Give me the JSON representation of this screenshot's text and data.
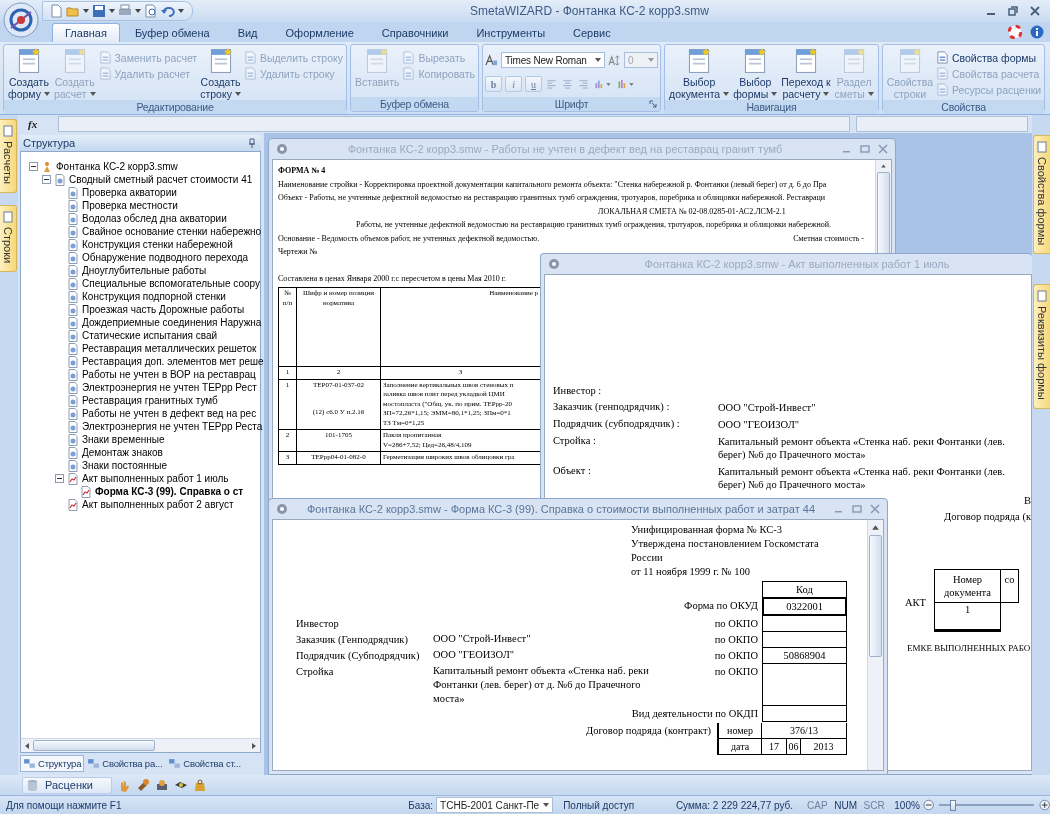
{
  "app": {
    "title": "SmetaWIZARD - Фонтанка КС-2 корр3.smw"
  },
  "ribbon_tabs": [
    {
      "label": "Главная",
      "selected": true
    },
    {
      "label": "Буфер обмена",
      "selected": false
    },
    {
      "label": "Вид",
      "selected": false
    },
    {
      "label": "Оформление",
      "selected": false
    },
    {
      "label": "Справочники",
      "selected": false
    },
    {
      "label": "Инструменты",
      "selected": false
    },
    {
      "label": "Сервис",
      "selected": false
    }
  ],
  "ribbon_groups": [
    {
      "title": "Редактирование",
      "items": [
        {
          "kind": "large",
          "lines": [
            "Создать",
            "форму"
          ],
          "dropdown": true,
          "disabled": false
        },
        {
          "kind": "large",
          "lines": [
            "Создать",
            "расчет"
          ],
          "dropdown": true,
          "disabled": true
        },
        {
          "kind": "stack",
          "buttons": [
            {
              "label": "Заменить расчет",
              "disabled": true
            },
            {
              "label": "Удалить расчет",
              "disabled": true
            }
          ]
        },
        {
          "kind": "large",
          "lines": [
            "Создать",
            "строку"
          ],
          "dropdown": true,
          "disabled": false
        },
        {
          "kind": "stack",
          "buttons": [
            {
              "label": "Выделить строку",
              "disabled": true
            },
            {
              "label": "Удалить строку",
              "disabled": true
            }
          ]
        }
      ]
    },
    {
      "title": "Буфер обмена",
      "items": [
        {
          "kind": "large",
          "lines": [
            "Вставить"
          ],
          "dropdown": false,
          "disabled": true
        },
        {
          "kind": "stack",
          "buttons": [
            {
              "label": "Вырезать",
              "disabled": true
            },
            {
              "label": "Копировать",
              "disabled": true
            }
          ]
        }
      ]
    },
    {
      "title": "Шрифт",
      "items": [
        {
          "kind": "font",
          "font_field": {
            "value": "Times New Roman"
          },
          "size_field": {
            "value": "0",
            "disabled": true
          },
          "format": [
            "b",
            "i",
            "u"
          ]
        }
      ]
    },
    {
      "title": "Навигация",
      "items": [
        {
          "kind": "large",
          "lines": [
            "Выбор",
            "документа"
          ],
          "dropdown": true,
          "disabled": false
        },
        {
          "kind": "large",
          "lines": [
            "Выбор",
            "формы"
          ],
          "dropdown": true,
          "disabled": false
        },
        {
          "kind": "large",
          "lines": [
            "Переход к",
            "расчету"
          ],
          "dropdown": true,
          "disabled": false
        },
        {
          "kind": "large",
          "lines": [
            "Раздел",
            "сметы"
          ],
          "dropdown": true,
          "disabled": true
        }
      ]
    },
    {
      "title": "Свойства",
      "items": [
        {
          "kind": "large",
          "lines": [
            "Свойства",
            "строки"
          ],
          "dropdown": false,
          "disabled": true
        },
        {
          "kind": "stack",
          "buttons": [
            {
              "label": "Свойства формы",
              "disabled": false
            },
            {
              "label": "Свойства расчета",
              "disabled": true
            },
            {
              "label": "Ресурсы расценки",
              "disabled": true
            }
          ]
        }
      ]
    }
  ],
  "formula_bar": {
    "label": "fx"
  },
  "left_tabs": [
    {
      "label": "Расчеты"
    },
    {
      "label": "Строки"
    }
  ],
  "right_tabs": [
    {
      "label": "Свойства формы"
    },
    {
      "label": "Реквизиты формы"
    }
  ],
  "structure": {
    "title": "Структура",
    "tree": [
      {
        "label": "Фонтанка КС-2 корр3.smw",
        "kind": "file",
        "expanded": true,
        "selected": false,
        "children": [
          {
            "label": "Сводный сметный расчет стоимости 41",
            "kind": "summary",
            "expanded": true,
            "selected": false,
            "children": [
              {
                "label": "Проверка акватории",
                "kind": "calc",
                "selected": false
              },
              {
                "label": "Проверка местности",
                "kind": "calc",
                "selected": false
              },
              {
                "label": "Водолаз обслед дна акватории",
                "kind": "calc",
                "selected": false
              },
              {
                "label": "Свайное основание стенки набережно",
                "kind": "calc",
                "selected": false
              },
              {
                "label": "Конструкция стенки набережной",
                "kind": "calc",
                "selected": false
              },
              {
                "label": "Обнаружение подводного перехода",
                "kind": "calc",
                "selected": false
              },
              {
                "label": "Дноуглубительные работы",
                "kind": "calc",
                "selected": false
              },
              {
                "label": "Специальные вспомогательные соору",
                "kind": "calc",
                "selected": false
              },
              {
                "label": "Конструкция подпорной стенки",
                "kind": "calc",
                "selected": false
              },
              {
                "label": "Проезжая часть Дорожные работы",
                "kind": "calc",
                "selected": false
              },
              {
                "label": "Дождеприемные соединения Наружна",
                "kind": "calc",
                "selected": false
              },
              {
                "label": "Статические испытания свай",
                "kind": "calc",
                "selected": false
              },
              {
                "label": "Реставрация металлических решеток",
                "kind": "calc",
                "selected": false
              },
              {
                "label": "Реставрация доп. элементов мет реше",
                "kind": "calc",
                "selected": false
              },
              {
                "label": "Работы не учтен в ВОР на реставрац",
                "kind": "calc",
                "selected": false
              },
              {
                "label": "Электроэнергия не учтен ТЕРрр Рест",
                "kind": "calc",
                "selected": false
              },
              {
                "label": "Реставрация гранитных тумб",
                "kind": "calc",
                "selected": false
              },
              {
                "label": "Работы не учтен в дефект вед на рес",
                "kind": "calc",
                "selected": false
              },
              {
                "label": "Электроэнергия не учтен ТЕРрр Реста",
                "kind": "calc",
                "selected": false
              },
              {
                "label": "Знаки временные",
                "kind": "calc",
                "selected": false
              },
              {
                "label": "Демонтаж знаков",
                "kind": "calc",
                "selected": false
              },
              {
                "label": "Знаки постоянные",
                "kind": "calc",
                "selected": false
              },
              {
                "label": "Акт выполненных работ 1 июль",
                "kind": "act",
                "expanded": true,
                "selected": false,
                "children": [
                  {
                    "label": "Форма КС-3 (99). Справка о ст",
                    "kind": "form",
                    "selected": true
                  }
                ]
              },
              {
                "label": "Акт выполненных работ 2 август",
                "kind": "act",
                "selected": false
              }
            ]
          }
        ]
      }
    ],
    "bottom_tabs": [
      {
        "label": "Структура",
        "selected": true
      },
      {
        "label": "Свойства ра...",
        "selected": false
      },
      {
        "label": "Свойства ст...",
        "selected": false
      }
    ]
  },
  "windows": [
    {
      "kind": "estimate",
      "title": "Фонтанка КС-2 корр3.smw - Работы не учтен в дефект вед на реставрац гранит тумб",
      "active": false,
      "form_label": "ФОРМА № 4",
      "lines": [
        "Наименование стройки - Корректировка проектной документации капитального ремонта объекта: \"Стенка набережной р. Фонтанки (левый берег) от д. 6 до Пра",
        "Объект - Работы, не учтенные дефектной ведомостью на реставрацию гранитных тумб ограждения, тротуаров, поребрика и облицовки набережной. Реставраци"
      ],
      "heading": "ЛОКАЛЬНАЯ СМЕТА № 02-08.0285-01-АС2.ЛСМ-2.1",
      "subheading": "Работы, не учтенные дефектной ведомостью на реставрацию гранитных тумб ограждения, тротуаров, поребрика и облицовки набережной.",
      "basis": "Основание - Ведомость объемов работ, не учтенных дефектной ведомостью.",
      "cost_label": "Сметная стоимость -",
      "drawings": "Чертежи №",
      "prices": "Составлена в ценах Января 2000 г.с пересчетом в цены Мая 2010 г.",
      "table": {
        "columns": [
          "№ п/п",
          "Шифр и номер позиции норматива",
          "Наименование р"
        ],
        "column_numbers": [
          "1",
          "2",
          "3"
        ],
        "rows": [
          {
            "num": "1",
            "code": [
              "ТЕР07-01-037-02",
              "(12) с6.0 У п.2.16"
            ],
            "desc": [
              "Заполнение вертикальных швов стеновых п",
              "заливка швов плит перед укладкой ЦМИ",
              "мостопласта (\"Общ. ук. по прим. ТЕРрр-20",
              "ЗП=72,26*1,15; ЭММ=80,1*1,25; ЗПм=0*1",
              "ТЗ Тм=0*1,25"
            ]
          },
          {
            "num": "2",
            "code": [
              "101-1705"
            ],
            "desc": [
              "Пакля пропитанная",
              "V=286+7,52; Цед=26,48/4,109"
            ]
          },
          {
            "num": "3",
            "code": [
              "ТЕРрр04-01-082-0"
            ],
            "desc": [
              "Герметизация широких швов облицовки гра"
            ]
          }
        ]
      }
    },
    {
      "kind": "act",
      "title": "Фонтанка КС-2 корр3.smw - Акт выполненных работ 1 июль",
      "active": false,
      "fields": [
        {
          "label": "Инвестор :"
        },
        {
          "label": "Заказчик (генподрядчик) :",
          "value": "ООО \"Строй-Инвест\""
        },
        {
          "label": "Подрядчик (субподрядчик) :",
          "value": "ООО \"ГЕОИЗОЛ\""
        },
        {
          "label": "Стройка :",
          "value": "Капитальный ремонт объекта «Стенка наб. реки Фонтанки (лев. берег) №6 до Прачечного моста»"
        },
        {
          "label": "Объект :",
          "value": "Капитальный ремонт объекта «Стенка наб. реки Фонтанки (лев. берег) №6 до Прачечного моста»"
        }
      ],
      "right_lines": [
        "В",
        "Договор подряда (к"
      ],
      "doc_table": {
        "row_label": "АКТ",
        "columns": [
          "Номер документа",
          "со"
        ],
        "values": [
          "1"
        ]
      },
      "footer": "ЕМКЕ ВЫПОЛНЕННЫХ РАБО"
    },
    {
      "kind": "ks3",
      "title": "Фонтанка КС-2 корр3.smw - Форма КС-3 (99). Справка о стоимости выполненных работ и затрат 44",
      "active": true,
      "header": [
        "Унифицированная форма № КС-3",
        "Утверждена постановлением Госкомстата России",
        "от 11 ноября 1999 г. № 100"
      ],
      "code_header": "Код",
      "rows": [
        {
          "code_label": "Форма по ОКУД",
          "code": "0322001"
        },
        {
          "party": {
            "label": "Инвестор"
          },
          "code_label": "по ОКПО"
        },
        {
          "party": {
            "label": "Заказчик (Генподрядчик)",
            "value": "ООО \"Строй-Инвест\""
          },
          "code_label": "по ОКПО"
        },
        {
          "party": {
            "label": "Подрядчик (Субподрядчик)",
            "value": "ООО \"ГЕОИЗОЛ\""
          },
          "code_label": "по ОКПО",
          "code": "50868904"
        },
        {
          "party": {
            "label": "Стройка",
            "value": "Капитальный ремонт объекта «Стенка наб. реки Фонтанки (лев. берег) от д. №6 до Прачечного моста»"
          },
          "code_label": "по ОКПО"
        },
        {
          "code_label": "Вид деятельности по ОКДП"
        }
      ],
      "contract": {
        "label": "Договор подряда (контракт)",
        "number_label": "номер",
        "number": "376/13",
        "date_label": "дата",
        "date": [
          "17",
          "06",
          "2013"
        ]
      }
    }
  ],
  "bottom_bar": {
    "label": "Расценки"
  },
  "status_bar": {
    "help": "Для помощи нажмите F1",
    "base_label": "База:",
    "base_value": "ТСНБ-2001 Санкт-Пе",
    "access": "Полный доступ",
    "sum": "Сумма: 2 229 224,77 руб.",
    "indicators": [
      {
        "label": "CAP",
        "on": false
      },
      {
        "label": "NUM",
        "on": true
      },
      {
        "label": "SCR",
        "on": false
      }
    ],
    "zoom": "100%",
    "zoom_slider": {
      "level": 0.15
    }
  }
}
